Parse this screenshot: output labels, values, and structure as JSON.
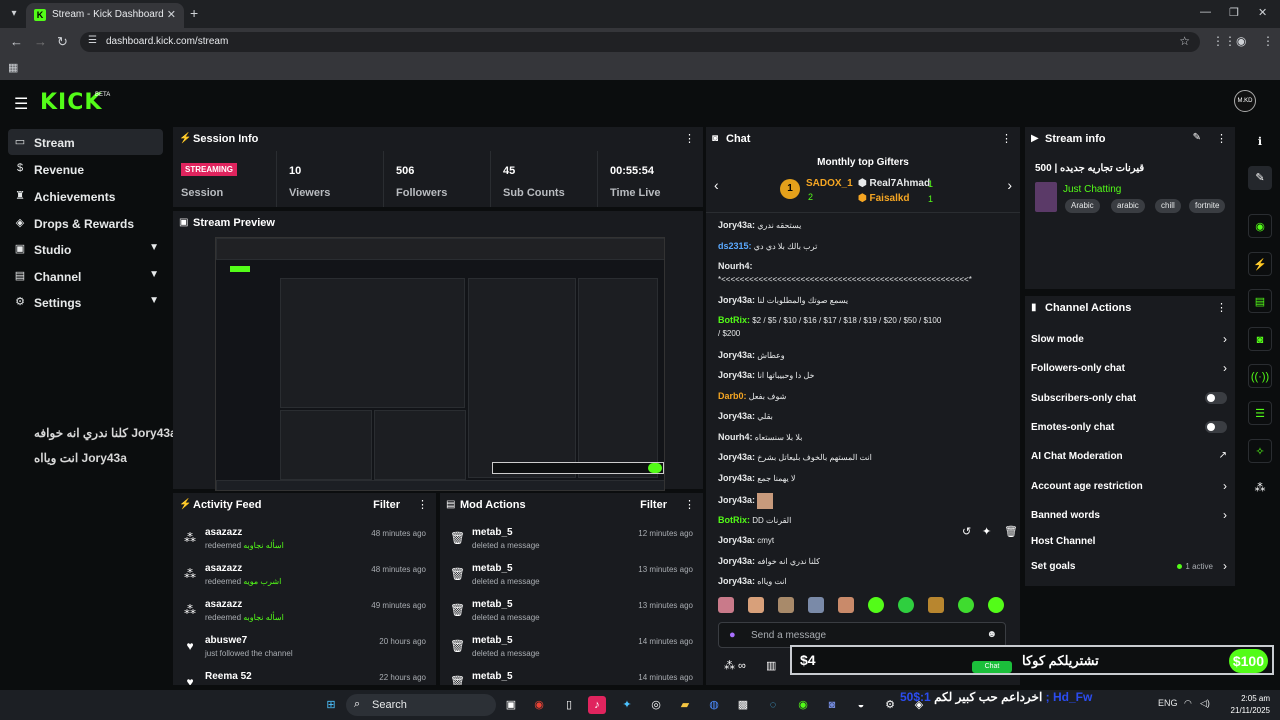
{
  "browser": {
    "tab_title": "Stream - Kick Dashboard",
    "url": "dashboard.kick.com/stream",
    "favicon_letter": "K"
  },
  "header": {
    "logo": "KICK",
    "beta": "BETA",
    "avatar": "M.KD"
  },
  "sidebar": {
    "items": [
      {
        "label": "Stream",
        "icon": "stream-icon"
      },
      {
        "label": "Revenue",
        "icon": "dollar-icon"
      },
      {
        "label": "Achievements",
        "icon": "trophy-icon"
      },
      {
        "label": "Drops & Rewards",
        "icon": "gift-icon"
      },
      {
        "label": "Studio",
        "icon": "studio-icon"
      },
      {
        "label": "Channel",
        "icon": "channel-icon"
      },
      {
        "label": "Settings",
        "icon": "gear-icon"
      }
    ]
  },
  "overlay_left": {
    "line1": "كلنا ندري انه خوافه Jory43a",
    "line2": "انت ويااه Jory43a"
  },
  "session": {
    "title": "Session Info",
    "status": "STREAMING",
    "status_label": "Session",
    "stats": [
      {
        "value": "10",
        "label": "Viewers"
      },
      {
        "value": "506",
        "label": "Followers"
      },
      {
        "value": "45",
        "label": "Sub Counts"
      },
      {
        "value": "00:55:54",
        "label": "Time Live"
      }
    ]
  },
  "preview": {
    "title": "Stream Preview"
  },
  "activity": {
    "title": "Activity Feed",
    "filter": "Filter",
    "rows": [
      {
        "user": "asazazz",
        "action": "redeemed",
        "highlight": "اسأله نجاوبه",
        "time": "48 minutes ago",
        "icon": "reward-icon"
      },
      {
        "user": "asazazz",
        "action": "redeemed",
        "highlight": "اشرب مويه",
        "time": "48 minutes ago",
        "icon": "reward-icon"
      },
      {
        "user": "asazazz",
        "action": "redeemed",
        "highlight": "اسأله نجاوبه",
        "time": "49 minutes ago",
        "icon": "reward-icon"
      },
      {
        "user": "abuswe7",
        "action": "just followed the channel",
        "highlight": "",
        "time": "20 hours ago",
        "icon": "heart-icon"
      },
      {
        "user": "Reema 52",
        "action": "",
        "highlight": "",
        "time": "22 hours ago",
        "icon": "heart-icon"
      }
    ]
  },
  "mod_actions": {
    "title": "Mod Actions",
    "filter": "Filter",
    "rows": [
      {
        "user": "metab_5",
        "action": "deleted a message",
        "time": "12 minutes ago"
      },
      {
        "user": "metab_5",
        "action": "deleted a message",
        "time": "13 minutes ago"
      },
      {
        "user": "metab_5",
        "action": "deleted a message",
        "time": "13 minutes ago"
      },
      {
        "user": "metab_5",
        "action": "deleted a message",
        "time": "14 minutes ago"
      },
      {
        "user": "metab_5",
        "action": "",
        "time": "14 minutes ago"
      }
    ]
  },
  "chat": {
    "title": "Chat",
    "gifters_title": "Monthly top Gifters",
    "top": {
      "rank": "1",
      "name": "SADOX_1",
      "count": "2"
    },
    "gifter2": {
      "name": "Real7Ahmad",
      "count": "1"
    },
    "gifter3": {
      "name": "Faisalkd",
      "count": "1"
    },
    "messages": [
      {
        "user": "Jory43a:",
        "text": "يستحقه ندري",
        "color": "#e7e9ea"
      },
      {
        "user": "ds2315:",
        "text": "ترب بالك بلا دي دي",
        "color": "#5aa9ff"
      },
      {
        "user": "Nourh4:",
        "text": "",
        "color": "#e7e9ea"
      },
      {
        "user": "",
        "text": "*<<<<<<<<<<<<<<<<<<<<<<<<<<<<<<<<<<<<<<<<<<<<<<<<<<<<<*",
        "color": "#e7e9ea"
      },
      {
        "user": "Jory43a:",
        "text": "يسمع صوتك والمطلوبات لنا",
        "color": "#e7e9ea"
      },
      {
        "user": "BotRix:",
        "text": "$2 / $5 / $10 / $16 / $17 / $18 / $19 / $20 / $50 / $100",
        "color": "#53fc18"
      },
      {
        "user": "",
        "text": "/ $200",
        "color": "#e7e9ea"
      },
      {
        "user": "Jory43a:",
        "text": "وعطاش",
        "color": "#e7e9ea"
      },
      {
        "user": "Jory43a:",
        "text": "خل دا وحبيباتها انا",
        "color": "#e7e9ea"
      },
      {
        "user": "Darb0:",
        "text": "شوف بفعل",
        "color": "#f5a623"
      },
      {
        "user": "Jory43a:",
        "text": "بقلي",
        "color": "#e7e9ea"
      },
      {
        "user": "Nourh4:",
        "text": "بلا بلا سنستعاه",
        "color": "#e7e9ea"
      },
      {
        "user": "Jory43a:",
        "text": "انت المستهم بالخوف بليعاتل بشرخ",
        "color": "#e7e9ea"
      },
      {
        "user": "Jory43a:",
        "text": "لا يهمنا جمع",
        "color": "#e7e9ea"
      },
      {
        "user": "Jory43a:",
        "text": "",
        "color": "#e7e9ea"
      },
      {
        "user": "BotRix:",
        "text": "DD القرنات",
        "color": "#53fc18"
      },
      {
        "user": "Jory43a:",
        "text": "cmyt",
        "color": "#e7e9ea"
      },
      {
        "user": "Jory43a:",
        "text": "كلنا ندري انه خوافه",
        "color": "#e7e9ea"
      },
      {
        "user": "Jory43a:",
        "text": "انت ويااه",
        "color": "#e7e9ea"
      }
    ],
    "send_placeholder": "Send a message"
  },
  "stream_info": {
    "title": "Stream info",
    "stream_title": "500 | قيرنات تجاريه جديده",
    "category": "Just Chatting",
    "tags": [
      "Arabic",
      "arabic",
      "chill",
      "fortnite"
    ]
  },
  "channel_actions": {
    "title": "Channel Actions",
    "rows": [
      {
        "label": "Slow mode",
        "control": "chevron"
      },
      {
        "label": "Followers-only chat",
        "control": "chevron"
      },
      {
        "label": "Subscribers-only chat",
        "control": "toggle"
      },
      {
        "label": "Emotes-only chat",
        "control": "toggle"
      },
      {
        "label": "AI Chat Moderation",
        "control": "external"
      },
      {
        "label": "Account age restriction",
        "control": "chevron"
      },
      {
        "label": "Banned words",
        "control": "chevron"
      },
      {
        "label": "Host Channel",
        "control": "none"
      },
      {
        "label": "Set goals",
        "control": "chevron",
        "extra": "1 active"
      }
    ]
  },
  "alert": {
    "amount_left": "$4",
    "text": "تشتريلكم كوكا",
    "amount_right": "$100",
    "bar_label": "Chat"
  },
  "ticker": {
    "text": "اخرداعم حب كبير لكم",
    "blue": "1:$50 ; Hd_Fw"
  },
  "taskbar": {
    "search": "Search",
    "lang": "ENG",
    "time": "2:05 am",
    "date": "21/11/2025"
  }
}
